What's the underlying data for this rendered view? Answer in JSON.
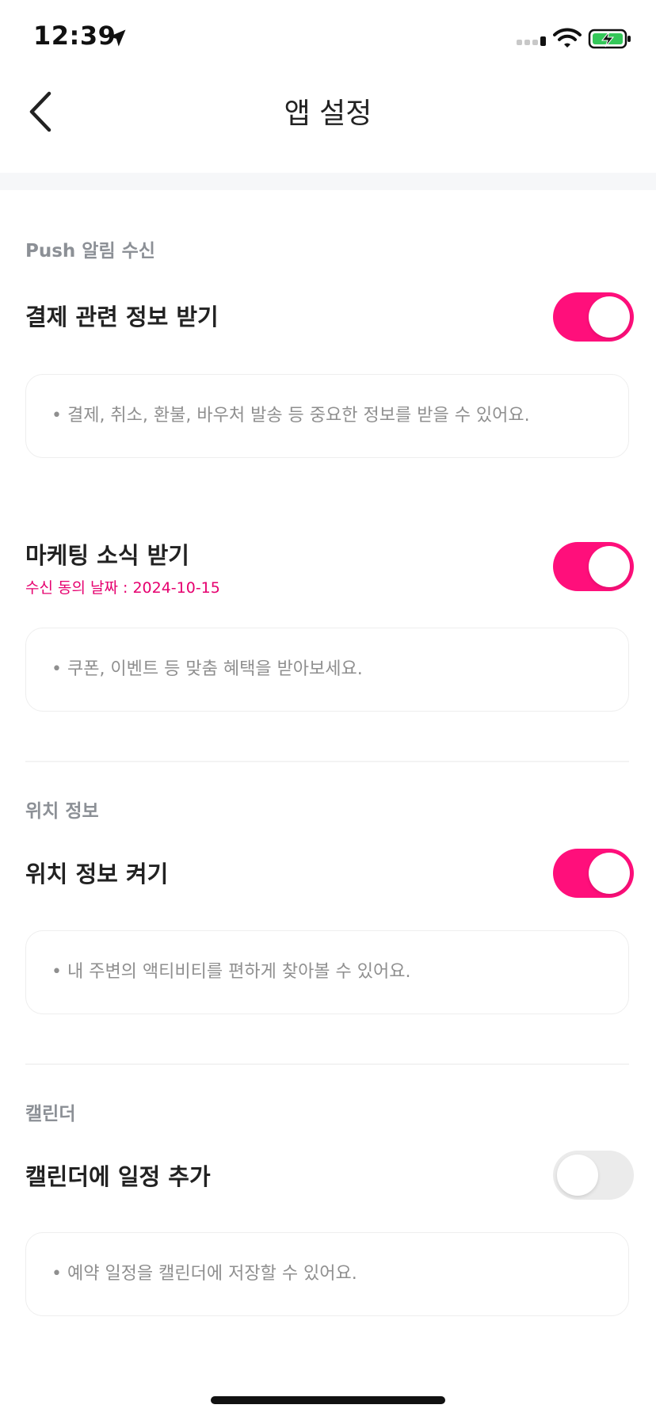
{
  "status_bar": {
    "time": "12:39"
  },
  "header": {
    "title": "앱 설정",
    "back_icon": "chevron-left-icon"
  },
  "sections": {
    "push": {
      "label": "Push 알림 수신",
      "payment": {
        "title": "결제 관련 정보 받기",
        "enabled": true,
        "description": "• 결제, 취소, 환불, 바우처 발송 등 중요한 정보를 받을 수 있어요."
      },
      "marketing": {
        "title": "마케팅 소식 받기",
        "consent_date": "수신 동의 날짜 : 2024-10-15",
        "enabled": true,
        "description": "• 쿠폰, 이벤트 등 맞춤 혜택을 받아보세요."
      }
    },
    "location": {
      "label": "위치 정보",
      "title": "위치 정보 켜기",
      "enabled": true,
      "description": "• 내 주변의 액티비티를 편하게 찾아볼 수 있어요."
    },
    "calendar": {
      "label": "캘린더",
      "title": "캘린더에 일정 추가",
      "enabled": false,
      "description": "• 예약 일정을 캘린더에 저장할 수 있어요."
    }
  },
  "colors": {
    "accent": "#ff0f7b",
    "consent_date": "#e6006f",
    "toggle_off": "#ebebeb",
    "section_label": "#8c9096",
    "description_text": "#8f8f8f"
  }
}
